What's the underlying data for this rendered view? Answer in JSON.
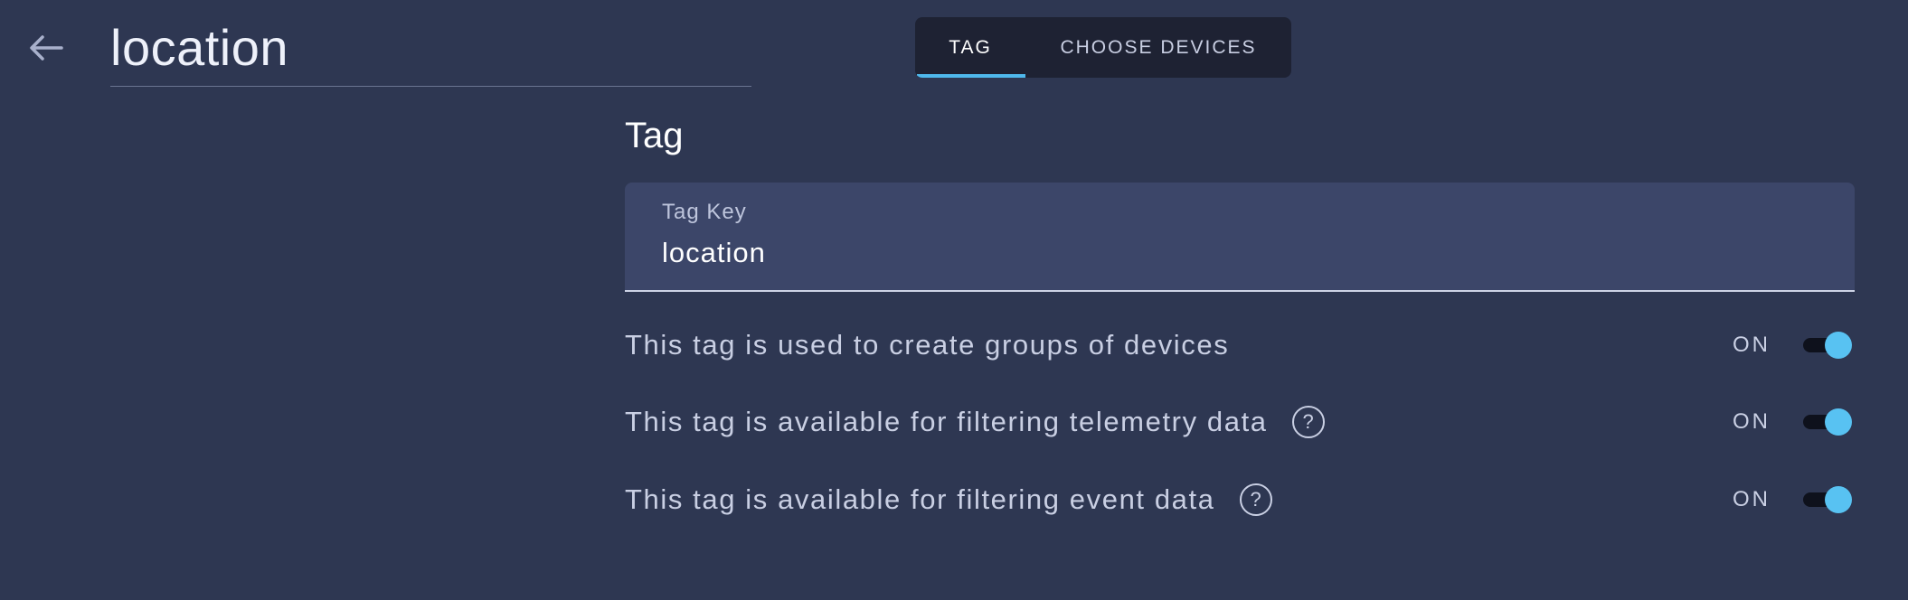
{
  "header": {
    "back_icon": "arrow-left-icon",
    "title": "location"
  },
  "tabs": [
    {
      "label": "TAG",
      "active": true
    },
    {
      "label": "CHOOSE DEVICES",
      "active": false
    }
  ],
  "section": {
    "title": "Tag"
  },
  "tag_key_field": {
    "label": "Tag Key",
    "value": "location"
  },
  "settings": [
    {
      "label": "This tag is used to create groups of devices",
      "has_help": false,
      "state_label": "ON",
      "enabled": true
    },
    {
      "label": "This tag is available for filtering telemetry data",
      "has_help": true,
      "help_icon": "question-circle-icon",
      "state_label": "ON",
      "enabled": true
    },
    {
      "label": "This tag is available for filtering event data",
      "has_help": true,
      "help_icon": "question-circle-icon",
      "state_label": "ON",
      "enabled": true
    }
  ],
  "colors": {
    "background": "#2e3752",
    "tab_bar": "#1e2233",
    "field_background": "#3c4669",
    "accent": "#4fb8ec",
    "toggle_on": "#58c2f2"
  }
}
